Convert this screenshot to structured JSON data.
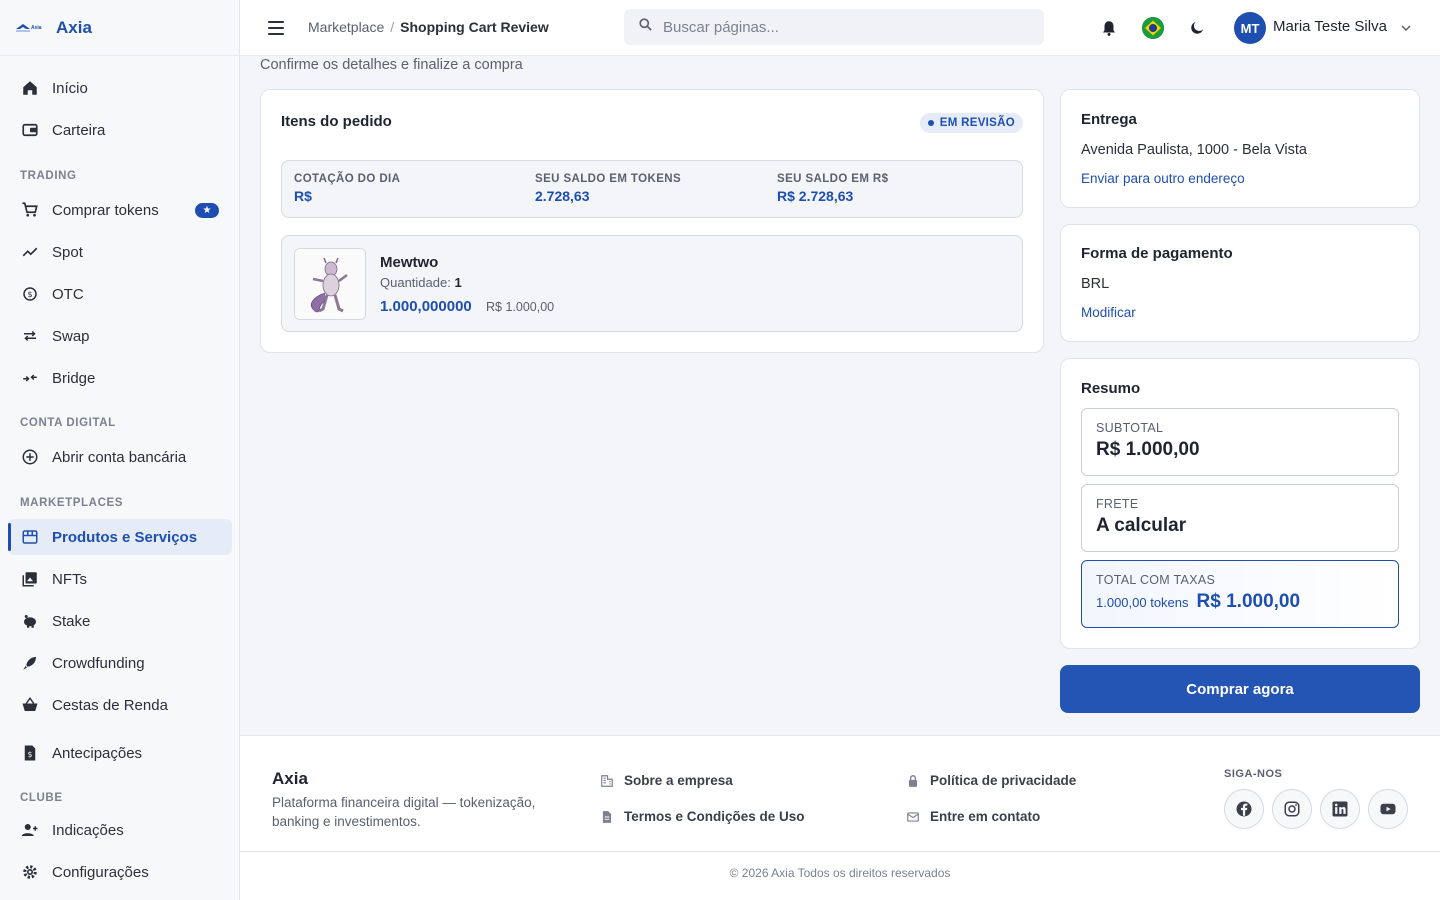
{
  "brand": {
    "logo_text": "Axia",
    "name": "Axia"
  },
  "sidebar": {
    "items": [
      {
        "label": "Início"
      },
      {
        "label": "Carteira"
      },
      {
        "label": "Comprar tokens"
      },
      {
        "label": "Spot"
      },
      {
        "label": "OTC"
      },
      {
        "label": "Swap"
      },
      {
        "label": "Bridge"
      },
      {
        "label": "Abrir conta bancária"
      },
      {
        "label": "Produtos e Serviços"
      },
      {
        "label": "NFTs"
      },
      {
        "label": "Stake"
      },
      {
        "label": "Crowdfunding"
      },
      {
        "label": "Cestas de Renda"
      },
      {
        "label": "Antecipações"
      },
      {
        "label": "Indicações"
      },
      {
        "label": "Configurações"
      }
    ],
    "sections": {
      "trading": "TRADING",
      "conta_digital": "CONTA DIGITAL",
      "marketplaces": "MARKETPLACES",
      "clube": "CLUBE"
    },
    "active_item": "Produtos e Serviços",
    "star_badge": "★"
  },
  "header": {
    "breadcrumb": [
      "Marketplace",
      "Shopping Cart Review"
    ],
    "separator": "/",
    "search_placeholder": "Buscar páginas...",
    "user": {
      "initials": "MT",
      "name": "Maria Teste Silva"
    }
  },
  "page": {
    "subtitle": "Confirme os detalhes e finalize a compra"
  },
  "order": {
    "title": "Itens do pedido",
    "status": "EM REVISÃO",
    "stats": [
      {
        "label": "COTAÇÃO DO DIA",
        "value": "R$"
      },
      {
        "label": "SEU SALDO EM TOKENS",
        "value": "2.728,63"
      },
      {
        "label": "SEU SALDO EM R$",
        "value": "R$ 2.728,63"
      }
    ],
    "item": {
      "name": "Mewtwo",
      "qty_label": "Quantidade:",
      "qty": "1",
      "tokens": "1.000,000000",
      "brl": "R$ 1.000,00"
    }
  },
  "delivery": {
    "title": "Entrega",
    "address": "Avenida Paulista, 1000 - Bela Vista",
    "link": "Enviar para outro endereço"
  },
  "payment": {
    "title": "Forma de pagamento",
    "method": "BRL",
    "link": "Modificar"
  },
  "summary": {
    "title": "Resumo",
    "subtotal_label": "SUBTOTAL",
    "subtotal": "R$ 1.000,00",
    "shipping_label": "FRETE",
    "shipping": "A calcular",
    "total_label": "TOTAL COM TAXAS",
    "total_tokens": "1.000,00 tokens",
    "total": "R$ 1.000,00"
  },
  "buy_button": "Comprar agora",
  "footer": {
    "brand": "Axia",
    "description": "Plataforma financeira digital — tokenização, banking e investimentos.",
    "links": [
      "Sobre a empresa",
      "Termos e Condições de Uso",
      "Política de privacidade",
      "Entre em contato"
    ],
    "follow": "SIGA-NOS",
    "copyright": "© 2026 Axia Todos os direitos reservados"
  },
  "colors": {
    "accent": "#1e4fb0",
    "button": "#2454b4",
    "background": "#f4f5f8"
  }
}
